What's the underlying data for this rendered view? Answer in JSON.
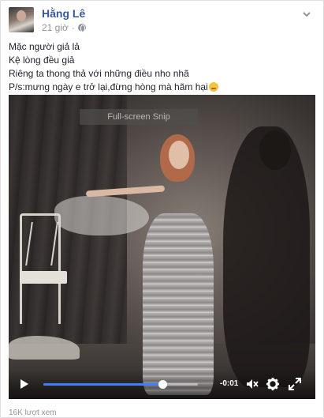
{
  "post": {
    "author": "Hằng Lê",
    "time": "21 giờ",
    "separator": "·",
    "lines": [
      "Mặc người giả lả",
      "Kệ lòng đều giả",
      "Riêng ta thong thả với những điều nho nhã",
      "P/s:mưng ngày e trở lại,đừng hòng mà hãm hại"
    ]
  },
  "video": {
    "overlay_label": "Full-screen Snip",
    "time_remaining": "-0:01",
    "progress": 0.77
  },
  "footer": {
    "views": "16K lượt xem"
  },
  "icons": {
    "privacy": "globe-icon",
    "menu": "chevron-down-icon",
    "play": "play-icon",
    "mute": "mute-icon",
    "settings": "gear-icon",
    "fullscreen": "fullscreen-icon",
    "emoji": "emoji-icon"
  },
  "colors": {
    "author": "#365899",
    "progress": "#4080ff",
    "muted_text": "#90949c"
  }
}
